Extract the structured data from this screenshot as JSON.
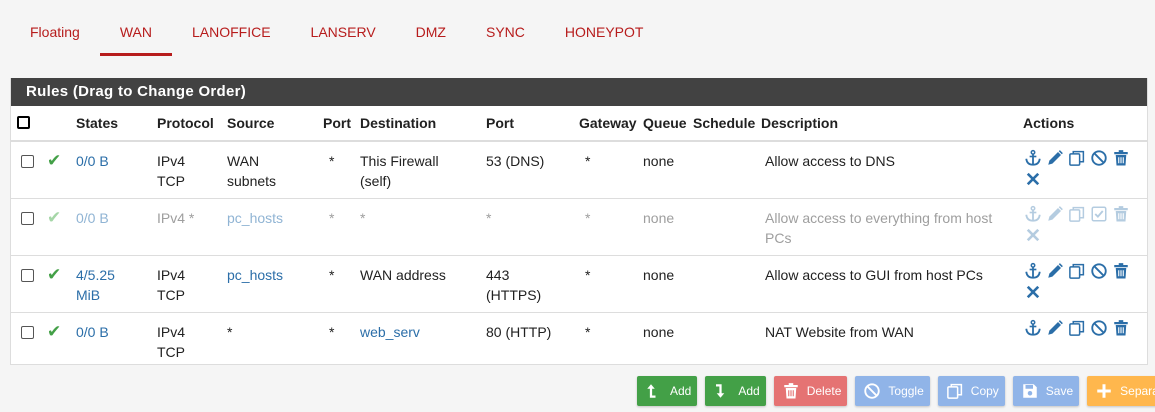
{
  "tabs": [
    "Floating",
    "WAN",
    "LANOFFICE",
    "LANSERV",
    "DMZ",
    "SYNC",
    "HONEYPOT"
  ],
  "active_tab": "WAN",
  "panel": {
    "title": "Rules (Drag to Change Order)"
  },
  "columns": {
    "states": "States",
    "protocol": "Protocol",
    "source": "Source",
    "port": "Port",
    "destination": "Destination",
    "dport": "Port",
    "gateway": "Gateway",
    "queue": "Queue",
    "schedule": "Schedule",
    "description": "Description",
    "actions": "Actions"
  },
  "rules": [
    {
      "enabled": true,
      "states": "0/0 B",
      "protocol": "IPv4\nTCP",
      "source": "WAN\nsubnets",
      "source_link": false,
      "sport": "*",
      "destination": "This Firewall\n(self)",
      "dest_link": false,
      "dport": "53 (DNS)",
      "gateway": "*",
      "queue": "none",
      "schedule": "",
      "description": "Allow access to DNS"
    },
    {
      "enabled": false,
      "states": "0/0 B",
      "protocol": "IPv4 *",
      "source": "pc_hosts",
      "source_link": true,
      "sport": "*",
      "destination": "*",
      "dest_link": false,
      "dport": "*",
      "gateway": "*",
      "queue": "none",
      "schedule": "",
      "description": "Allow access to everything from host\nPCs"
    },
    {
      "enabled": true,
      "states": "4/5.25\nMiB",
      "protocol": "IPv4\nTCP",
      "source": "pc_hosts",
      "source_link": true,
      "sport": "*",
      "destination": "WAN address",
      "dest_link": false,
      "dport": "443\n(HTTPS)",
      "gateway": "*",
      "queue": "none",
      "schedule": "",
      "description": "Allow access to GUI from host PCs"
    },
    {
      "enabled": true,
      "states": "0/0 B",
      "protocol": "IPv4\nTCP",
      "source": "*",
      "source_link": false,
      "sport": "*",
      "destination": "web_serv",
      "dest_link": true,
      "dport": "80 (HTTP)",
      "gateway": "*",
      "queue": "none",
      "schedule": "",
      "description": "NAT Website from WAN"
    }
  ],
  "row_actions": {
    "first_row": [
      "anchor-icon",
      "pencil-icon",
      "copy-icon",
      "ban-icon",
      "trash-icon",
      "times-icon"
    ],
    "disabled_row": [
      "anchor-icon",
      "pencil-icon",
      "copy-icon",
      "check-square-icon",
      "trash-icon",
      "times-icon"
    ],
    "third_row": [
      "anchor-icon",
      "pencil-icon",
      "copy-icon",
      "ban-icon",
      "trash-icon",
      "times-icon"
    ],
    "last_row": [
      "anchor-icon",
      "pencil-icon",
      "copy-icon",
      "ban-icon",
      "trash-icon"
    ]
  },
  "buttons": [
    {
      "label": "Add",
      "icon": "arrow-turn-up-icon",
      "color": "#43a047",
      "name": "add-top-button"
    },
    {
      "label": "Add",
      "icon": "arrow-turn-down-icon",
      "color": "#43a047",
      "name": "add-bottom-button"
    },
    {
      "label": "Delete",
      "icon": "trash-icon",
      "color": "#e57373",
      "name": "delete-button"
    },
    {
      "label": "Toggle",
      "icon": "ban-icon",
      "color": "#90b4e8",
      "name": "toggle-button"
    },
    {
      "label": "Copy",
      "icon": "copy-icon",
      "color": "#90b4e8",
      "name": "copy-button"
    },
    {
      "label": "Save",
      "icon": "save-icon",
      "color": "#90b4e8",
      "name": "save-button"
    },
    {
      "label": "Separator",
      "icon": "plus-icon",
      "color": "#ffb74d",
      "name": "separator-button"
    }
  ],
  "colors": {
    "accent": "#b71c1c",
    "link": "#2b6ea8",
    "header": "#424242",
    "check": "#43a047"
  }
}
